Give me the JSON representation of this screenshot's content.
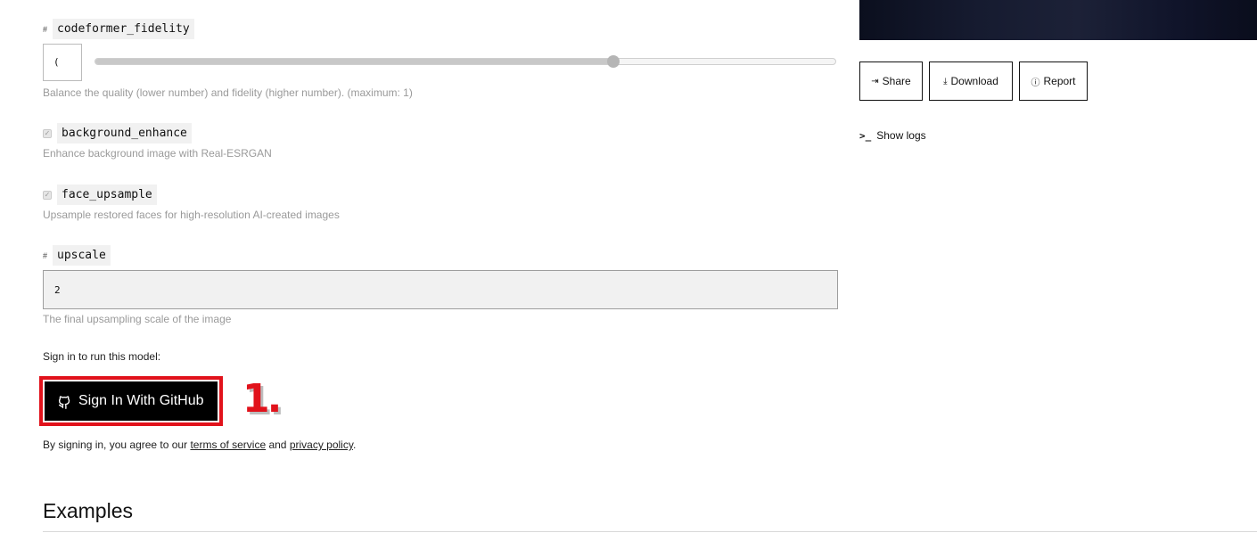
{
  "params": {
    "codeformer_fidelity": {
      "name": "codeformer_fidelity",
      "type_icon": "#",
      "value": "(",
      "slider_fraction": 0.7,
      "description": "Balance the quality (lower number) and fidelity (higher number). (maximum: 1)"
    },
    "background_enhance": {
      "name": "background_enhance",
      "checked": true,
      "check_mark": "✓",
      "description": "Enhance background image with Real-ESRGAN"
    },
    "face_upsample": {
      "name": "face_upsample",
      "checked": true,
      "check_mark": "✓",
      "description": "Upsample restored faces for high-resolution AI-created images"
    },
    "upscale": {
      "name": "upscale",
      "type_icon": "#",
      "value": "2",
      "description": "The final upsampling scale of the image"
    }
  },
  "signin": {
    "prompt": "Sign in to run this model:",
    "button_label": "Sign In With GitHub",
    "annotation": "1.",
    "agree_prefix": "By signing in, you agree to our ",
    "terms_label": "terms of service",
    "agree_and": " and ",
    "privacy_label": "privacy policy",
    "agree_suffix": "."
  },
  "examples": {
    "heading": "Examples"
  },
  "output": {
    "share_label": "Share",
    "download_label": "Download",
    "report_label": "Report",
    "show_logs_label": "Show logs",
    "share_icon": "⇥",
    "download_icon": "⤓",
    "report_icon": "ⓘ",
    "logs_icon": ">_"
  },
  "colors": {
    "accent_red": "#e1121b",
    "button_black": "#000000",
    "muted_text": "#9a9a9a"
  }
}
